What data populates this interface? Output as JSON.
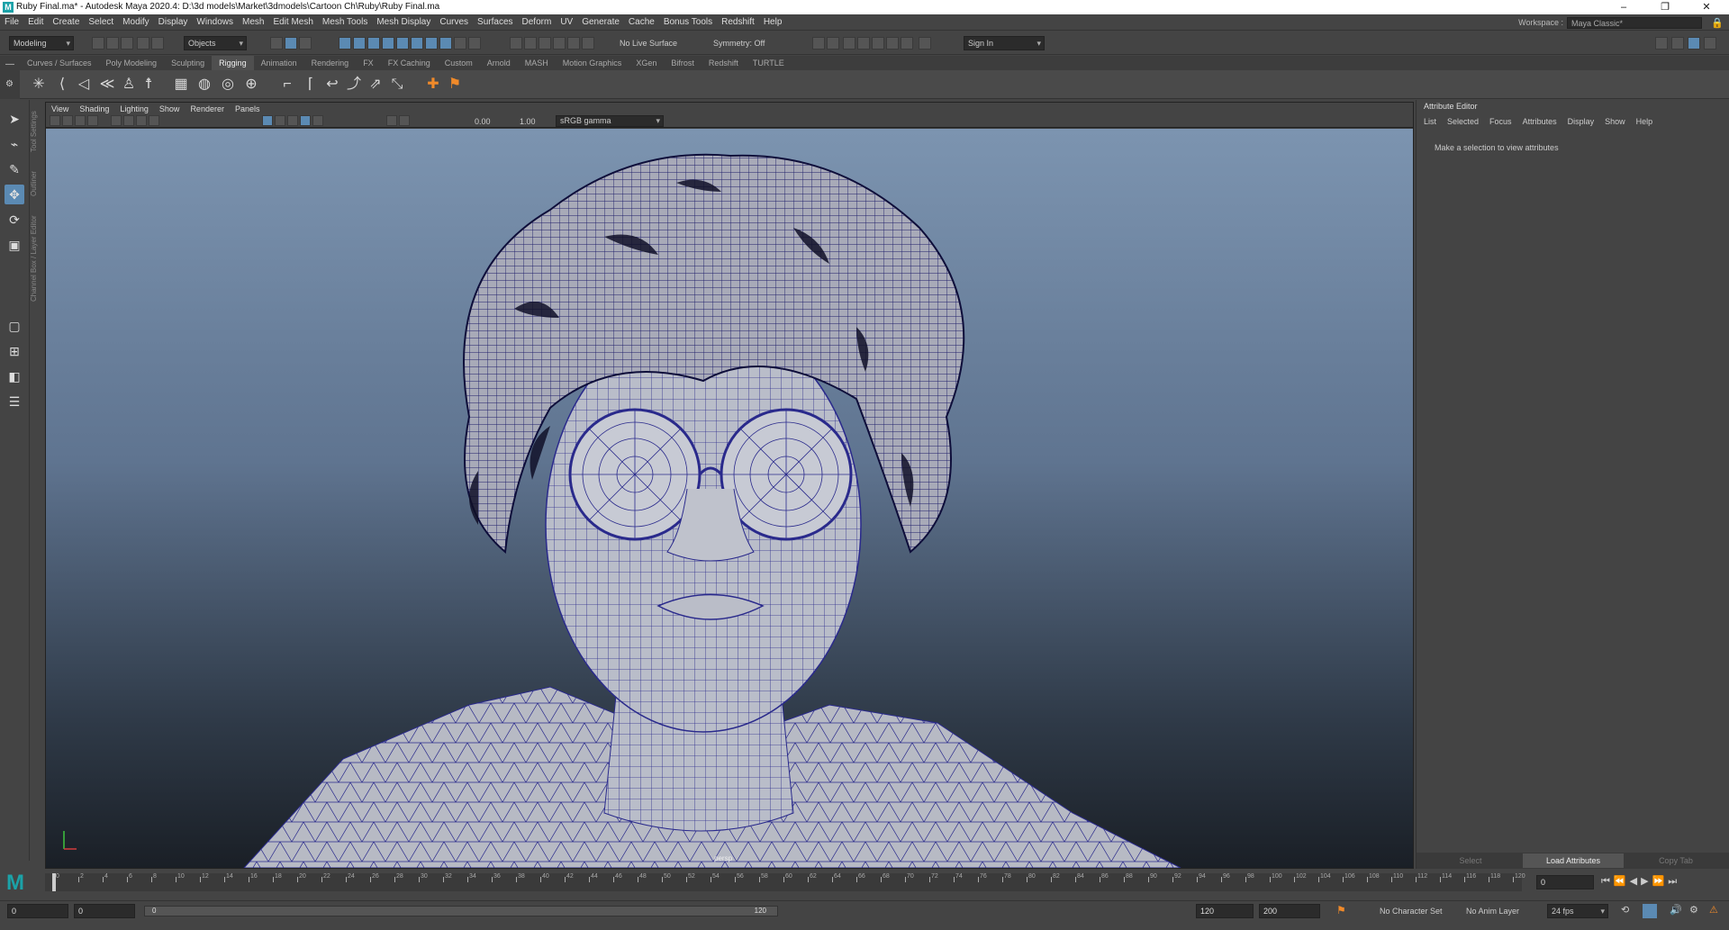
{
  "window": {
    "title": "Ruby Final.ma* - Autodesk Maya 2020.4: D:\\3d models\\Market\\3dmodels\\Cartoon Ch\\Ruby\\Ruby Final.ma",
    "logo": "M",
    "controls": [
      "–",
      "❐",
      "✕"
    ]
  },
  "menubar": {
    "items": [
      "File",
      "Edit",
      "Create",
      "Select",
      "Modify",
      "Display",
      "Windows",
      "Mesh",
      "Edit Mesh",
      "Mesh Tools",
      "Mesh Display",
      "Curves",
      "Surfaces",
      "Deform",
      "UV",
      "Generate",
      "Cache",
      "Bonus Tools",
      "Redshift",
      "Help"
    ],
    "workspace_label": "Workspace :",
    "workspace_value": "Maya Classic*"
  },
  "statusline": {
    "menuset": "Modeling",
    "selection_mode": "Objects",
    "live_surface": "No Live Surface",
    "symmetry": "Symmetry: Off",
    "sign_in": "Sign In"
  },
  "shelf": {
    "tabs": [
      "Curves / Surfaces",
      "Poly Modeling",
      "Sculpting",
      "Rigging",
      "Animation",
      "Rendering",
      "FX",
      "FX Caching",
      "Custom",
      "Arnold",
      "MASH",
      "Motion Graphics",
      "XGen",
      "Bifrost",
      "Redshift",
      "TURTLE"
    ],
    "active_tab": "Rigging",
    "icons": [
      "joint-icon",
      "ik-handle-icon",
      "ik-spline-icon",
      "insert-joint-icon",
      "humanik-icon",
      "quick-rig-icon",
      "skin-bind-icon",
      "smooth-bind-icon",
      "paint-weights-icon",
      "wrap-icon",
      "cluster-icon",
      "lattice-icon",
      "point-constraint-icon",
      "orient-constraint-icon",
      "aim-constraint-icon",
      "parent-constraint-icon",
      "pole-vector-icon",
      "locator-icon",
      "set-driven-key-icon"
    ]
  },
  "toolbox": {
    "side_tabs": [
      "Tool Settings",
      "Outliner",
      "Channel Box / Layer Editor"
    ]
  },
  "viewport": {
    "menu": [
      "View",
      "Shading",
      "Lighting",
      "Show",
      "Renderer",
      "Panels"
    ],
    "exposure": "0.00",
    "gamma": "1.00",
    "color_space": "sRGB gamma",
    "camera_label": "persp"
  },
  "attribute_editor": {
    "title": "Attribute Editor",
    "menu": [
      "List",
      "Selected",
      "Focus",
      "Attributes",
      "Display",
      "Show",
      "Help"
    ],
    "message": "Make a selection to view attributes",
    "buttons": [
      "Select",
      "Load Attributes",
      "Copy Tab"
    ]
  },
  "timeslider": {
    "ticks": [
      "0",
      "2",
      "4",
      "6",
      "8",
      "10",
      "12",
      "14",
      "16",
      "18",
      "20",
      "22",
      "24",
      "26",
      "28",
      "30",
      "32",
      "34",
      "36",
      "38",
      "40",
      "42",
      "44",
      "46",
      "48",
      "50",
      "52",
      "54",
      "56",
      "58",
      "60",
      "62",
      "64",
      "66",
      "68",
      "70",
      "72",
      "74",
      "76",
      "78",
      "80",
      "82",
      "84",
      "86",
      "88",
      "90",
      "92",
      "94",
      "96",
      "98",
      "100",
      "102",
      "104",
      "106",
      "108",
      "110",
      "112",
      "114",
      "116",
      "118",
      "120"
    ],
    "current_frame": "0"
  },
  "rangebar": {
    "start": "0",
    "playback_start": "0",
    "range_start_label": "0",
    "range_end_label": "120",
    "playback_end": "120",
    "end": "200",
    "character_set": "No Character Set",
    "anim_layer": "No Anim Layer",
    "fps": "24 fps"
  }
}
